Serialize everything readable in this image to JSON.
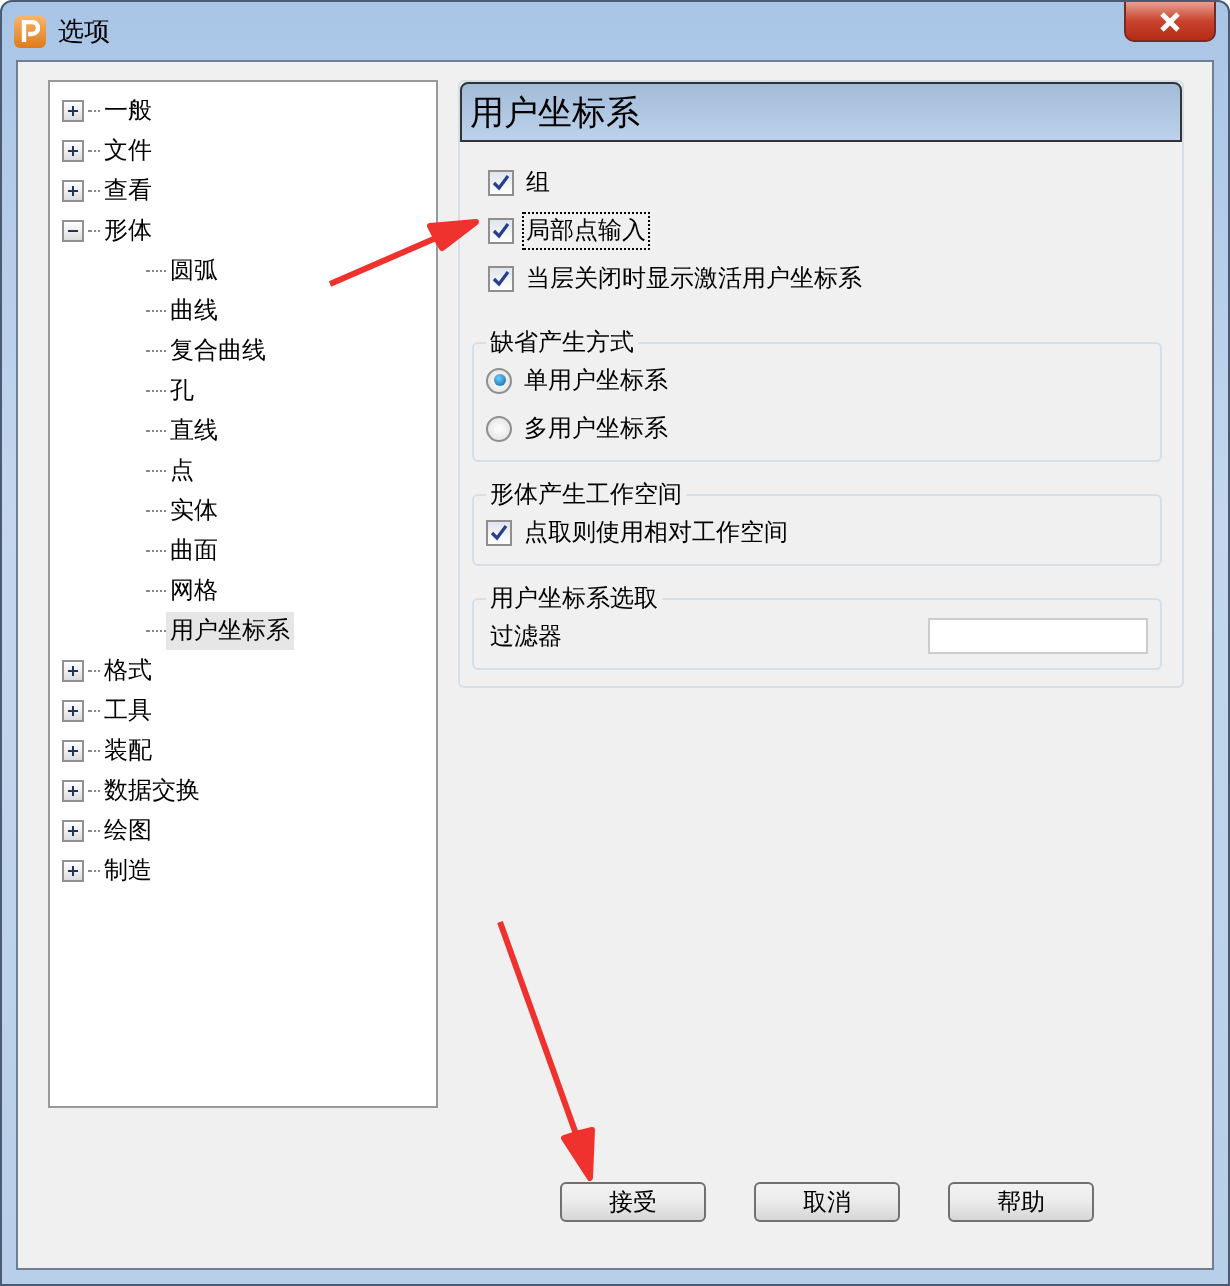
{
  "window": {
    "title": "选项"
  },
  "tree": [
    {
      "label": "一般",
      "expanded": false,
      "selected": false
    },
    {
      "label": "文件",
      "expanded": false,
      "selected": false
    },
    {
      "label": "查看",
      "expanded": false,
      "selected": false
    },
    {
      "label": "形体",
      "expanded": true,
      "selected": false,
      "children": [
        {
          "label": "圆弧",
          "selected": false
        },
        {
          "label": "曲线",
          "selected": false
        },
        {
          "label": "复合曲线",
          "selected": false
        },
        {
          "label": "孔",
          "selected": false
        },
        {
          "label": "直线",
          "selected": false
        },
        {
          "label": "点",
          "selected": false
        },
        {
          "label": "实体",
          "selected": false
        },
        {
          "label": "曲面",
          "selected": false
        },
        {
          "label": "网格",
          "selected": false
        },
        {
          "label": "用户坐标系",
          "selected": true
        }
      ]
    },
    {
      "label": "格式",
      "expanded": false,
      "selected": false
    },
    {
      "label": "工具",
      "expanded": false,
      "selected": false
    },
    {
      "label": "装配",
      "expanded": false,
      "selected": false
    },
    {
      "label": "数据交换",
      "expanded": false,
      "selected": false
    },
    {
      "label": "绘图",
      "expanded": false,
      "selected": false
    },
    {
      "label": "制造",
      "expanded": false,
      "selected": false
    }
  ],
  "panel": {
    "title": "用户坐标系",
    "options": [
      {
        "label": "组",
        "checked": true,
        "focused": false
      },
      {
        "label": "局部点输入",
        "checked": true,
        "focused": true
      },
      {
        "label": "当层关闭时显示激活用户坐标系",
        "checked": true,
        "focused": false
      }
    ],
    "groups": [
      {
        "title": "缺省产生方式",
        "items": [
          {
            "kind": "radio",
            "label": "单用户坐标系",
            "selected": true
          },
          {
            "kind": "radio",
            "label": "多用户坐标系",
            "selected": false
          }
        ]
      },
      {
        "title": "形体产生工作空间",
        "items": [
          {
            "kind": "checkbox",
            "label": "点取则使用相对工作空间",
            "checked": true
          }
        ]
      },
      {
        "title": "用户坐标系选取",
        "items": [
          {
            "kind": "field",
            "label": "过滤器"
          }
        ]
      }
    ]
  },
  "buttons": [
    "接受",
    "取消",
    "帮助"
  ]
}
